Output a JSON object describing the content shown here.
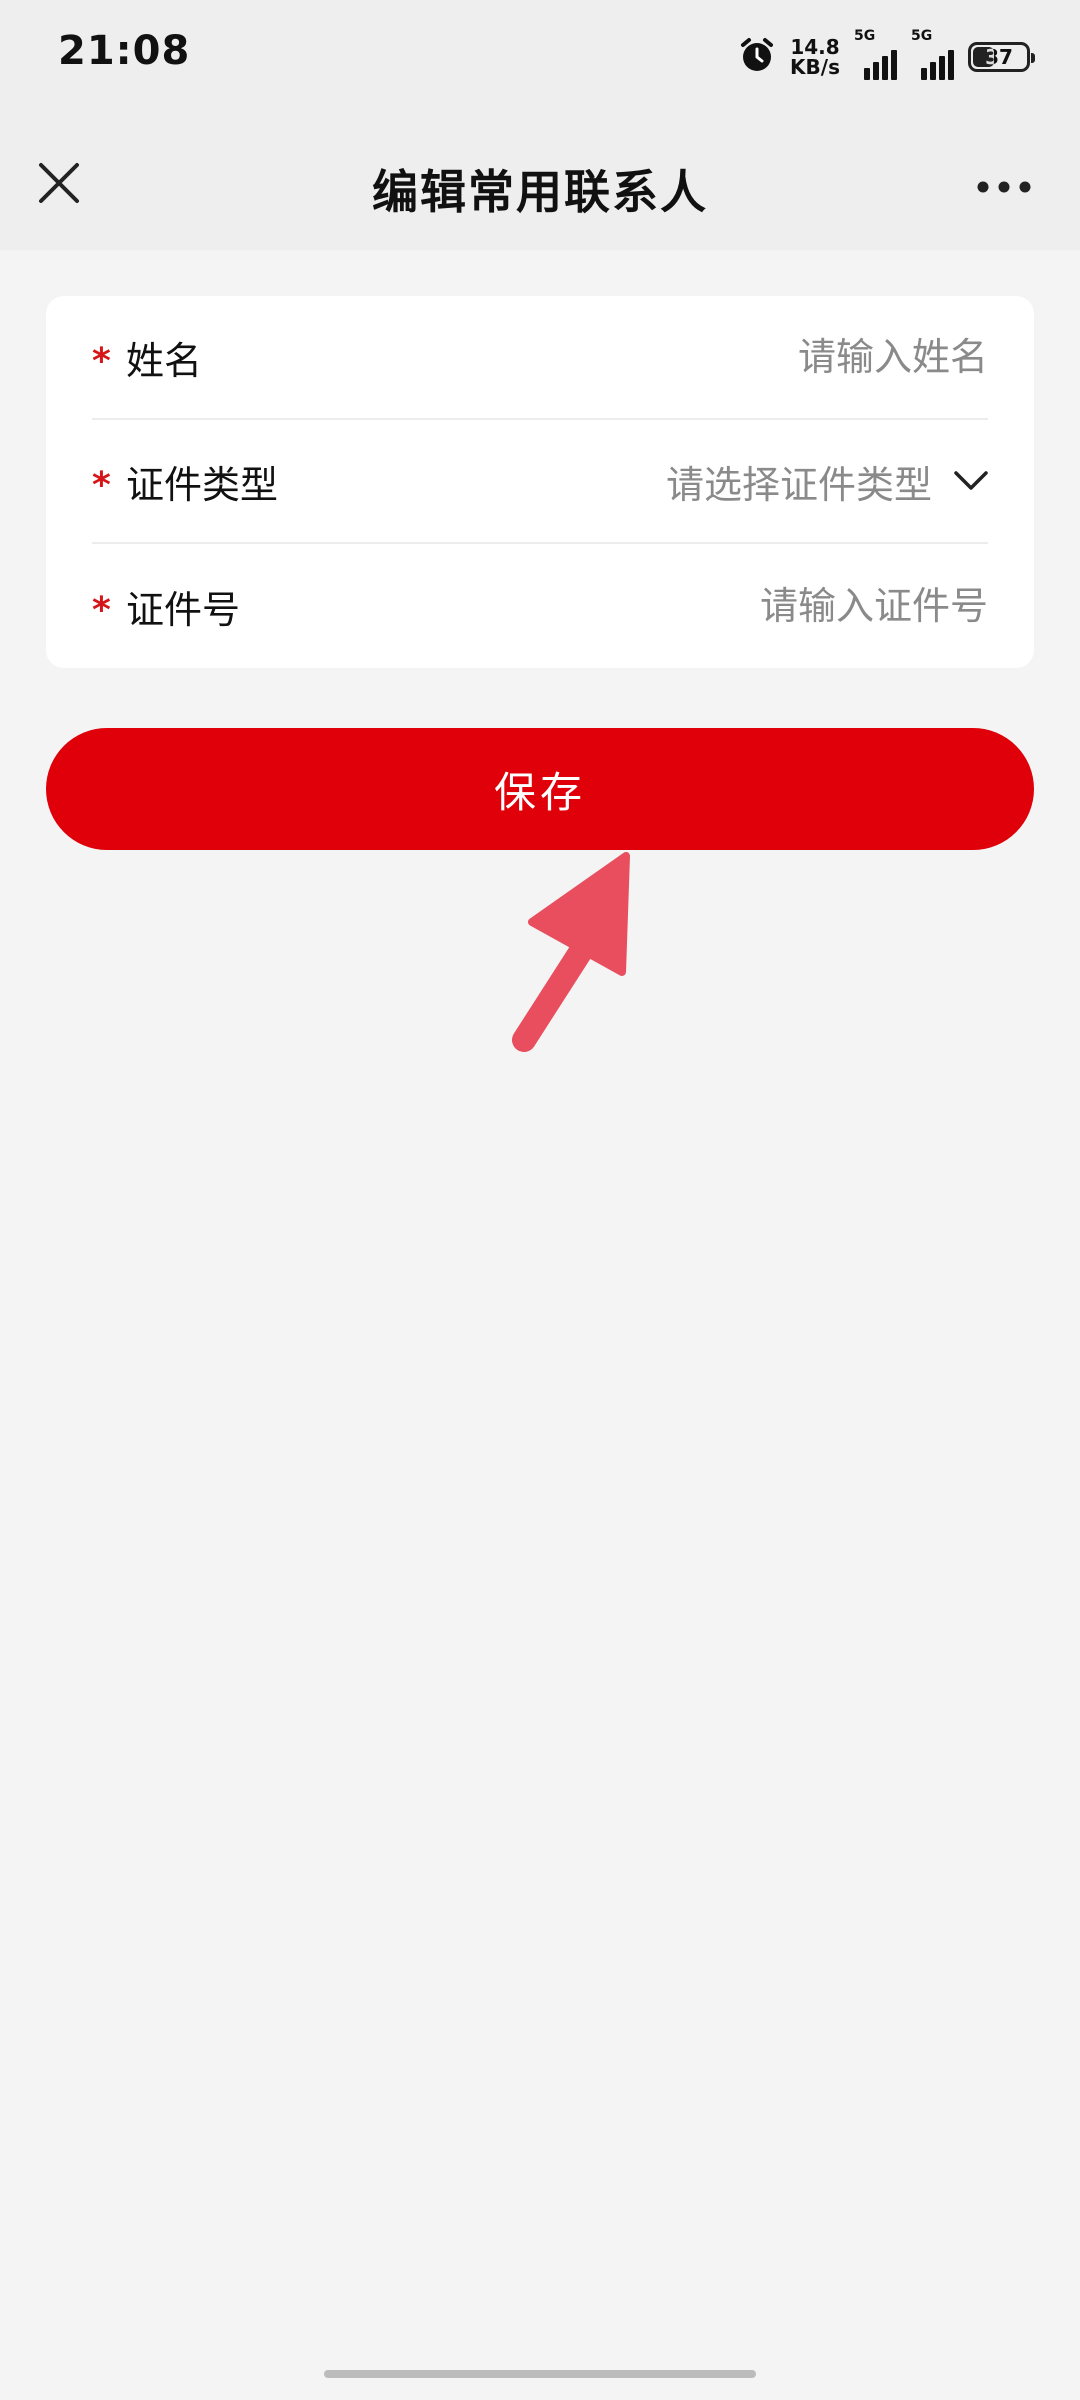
{
  "status_bar": {
    "time": "21:08",
    "net_speed_value": "14.8",
    "net_speed_unit": "KB/s",
    "signal1_label": "5G",
    "signal2_label": "5G",
    "battery": "37",
    "battery_level": 0.37,
    "icons": [
      "alarm-icon",
      "signal-icon",
      "battery-icon"
    ]
  },
  "nav": {
    "title": "编辑常用联系人",
    "close_icon": "close-icon",
    "more_icon": "more-icon"
  },
  "form": {
    "required_mark": "*",
    "name": {
      "label": "姓名",
      "value": "",
      "placeholder": "请输入姓名"
    },
    "id_type": {
      "label": "证件类型",
      "placeholder": "请选择证件类型",
      "icon": "chevron-down-icon"
    },
    "id_number": {
      "label": "证件号",
      "value": "",
      "placeholder": "请输入证件号"
    }
  },
  "save_button": {
    "label": "保存"
  },
  "colors": {
    "accent": "#df0009",
    "required": "#d61518",
    "placeholder": "#8a8a8a",
    "annotation": "#e84e5e",
    "background": "#f4f4f4"
  }
}
